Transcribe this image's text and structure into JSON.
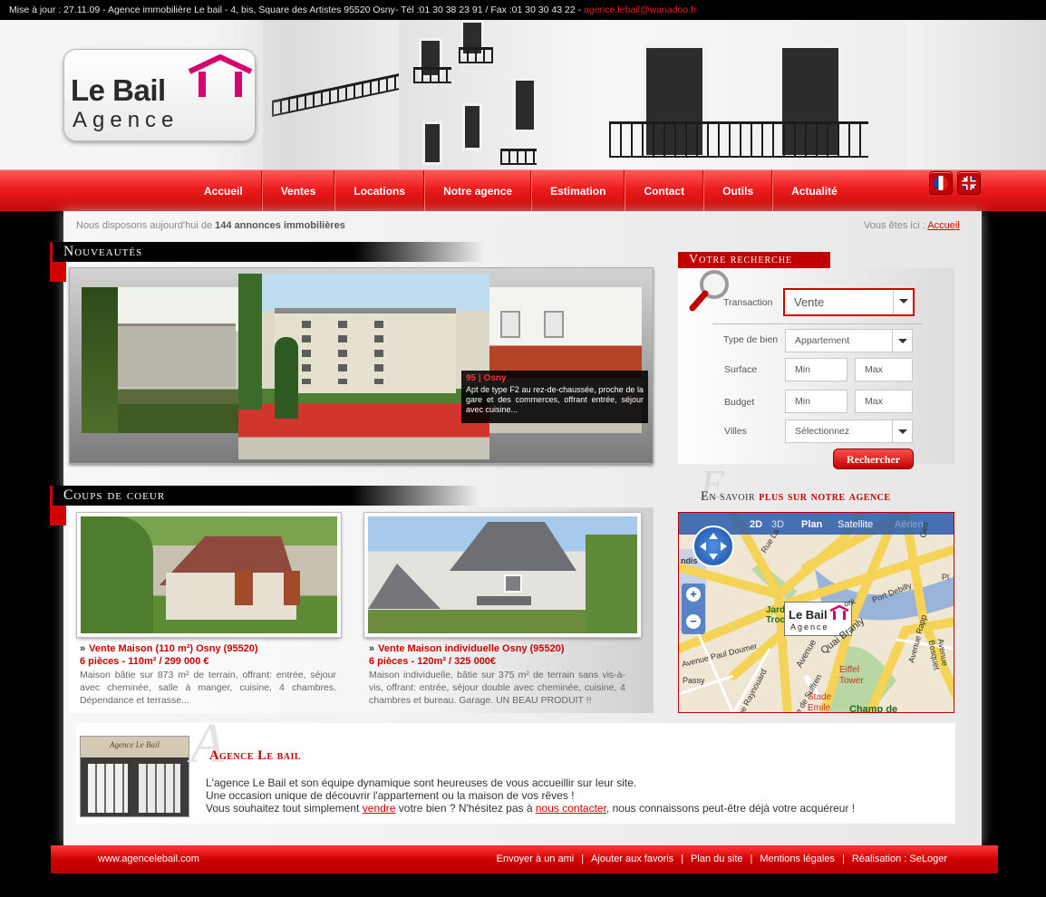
{
  "topbar": {
    "info": "Mise à jour : 27.11.09 - Agence immobilière Le bail - 4, bis, Square des Artistes 95520 Osny- Tél :01 30 38 23 91  / Fax :01 30 30 43 22 - ",
    "email": "agence.lebail@wanadoo.fr"
  },
  "logo": {
    "line1": "Le Bail",
    "line2": "Agence"
  },
  "nav": [
    "Accueil",
    "Ventes",
    "Locations",
    "Notre agence",
    "Estimation",
    "Contact",
    "Outils",
    "Actualité"
  ],
  "flags": [
    "fr-flag-icon",
    "uk-flag-icon"
  ],
  "intro": {
    "prefix": "Nous disposons aujourd'hui de ",
    "count": "144 annonces immobilières"
  },
  "breadcrumb": {
    "label": "Vous êtes ici : ",
    "current": "Accueil"
  },
  "nouveautes": {
    "heading": "Nouveautés",
    "caption_title": "95 | Osny",
    "caption_text": "Apt de type F2 au rez-de-chaussée, proche de la gare et des commerces, offrant entrée, séjour avec cuisine..."
  },
  "search": {
    "heading": "Votre recherche",
    "transaction_label": "Transaction",
    "transaction_value": "Vente",
    "type_label": "Type de bien",
    "type_value": "Appartement",
    "surface_label": "Surface",
    "budget_label": "Budget",
    "min": "Min",
    "max": "Max",
    "villes_label": "Villes",
    "villes_value": "Sélectionnez",
    "button": "Rechercher"
  },
  "agency_link": {
    "prefix": "En savoir ",
    "strong": "plus sur notre agence"
  },
  "map": {
    "tab_2d": "2D",
    "tab_3d": "3D",
    "tab_plan": "Plan",
    "tab_satellite": "Satellite",
    "tab_aerial": "Aérien",
    "streets": [
      "Rue La",
      "Port Debilly",
      "Avenue Paul Doumer",
      "Avenue",
      "Quai Branly",
      "Avenue Rapp",
      "Avenue Bosquet",
      "Eiffel Tower",
      "Stade Emile",
      "Champ de",
      "Passy",
      "Rue Raynouard",
      "Jard Troc",
      "Rue de Suffren",
      "Avenue de",
      "Geo",
      "ork",
      "Pl",
      "ndis"
    ],
    "logo_line1": "Le Bail",
    "logo_line2": "Agence"
  },
  "coups": {
    "heading": "Coups de coeur",
    "cards": [
      {
        "title": "Vente Maison (110 m²) Osny (95520)",
        "sub": "6 pièces - 110m² / 299 000 €",
        "desc": "Maison bâtie sur 873 m² de terrain, offrant: entrée, séjour avec cheminée, salle à manger, cuisine, 4 chambres. Dépendance et terrasse..."
      },
      {
        "title": "Vente Maison individuelle Osny (95520)",
        "sub": "6 pièces - 120m² / 325 000€",
        "desc": "Maison individuelle, bâtie sur 375 m² de terrain sans vis-à-vis, offrant: entrée, séjour double avec cheminée, cuisine, 4 chambres et bureau. Garage. UN BEAU PRODUIT !!"
      }
    ]
  },
  "about": {
    "heading": "Agence Le bail",
    "line1": "L'agence Le Bail et son équipe dynamique sont heureuses de vous accueillir sur leur site.",
    "line2": "Une occasion unique de découvrir l'appartement ou la maison de vos rêves !",
    "line3_a": "Vous souhaitez tout simplement ",
    "line3_link1": "vendre",
    "line3_b": " votre bien ? N'hésitez pas à ",
    "line3_link2": "nous contacter",
    "line3_c": ", nous connaissons peut-être déjà votre acquéreur !",
    "shop_sign": "Agence Le Bail"
  },
  "footer": {
    "site": "www.agencelebail.com",
    "links": [
      "Envoyer à un ami",
      "Ajouter aux favoris",
      "Plan du site",
      "Mentions légales",
      "Réalisation : SeLoger"
    ]
  },
  "colors": {
    "brand_red": "#e01010",
    "dark": "#000000"
  }
}
